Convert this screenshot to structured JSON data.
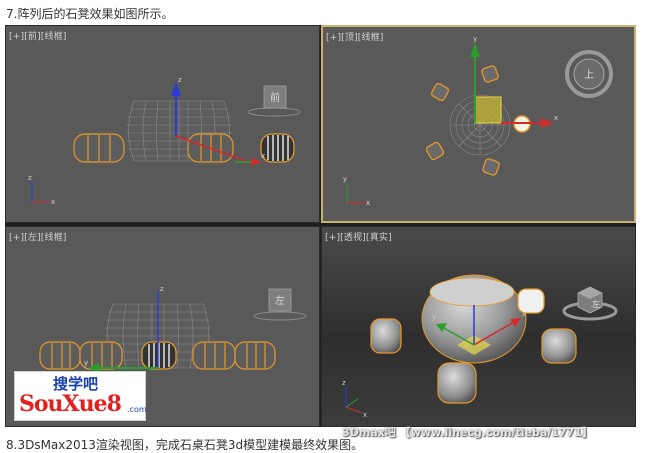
{
  "captions": {
    "top": "7.阵列后的石凳效果如图所示。",
    "bottom": "8.3DsMax2013渲染视图，完成石桌石凳3d模型建模最终效果图。"
  },
  "viewports": [
    {
      "id": "front",
      "label": "[+][前][线框]",
      "viewcube_label": "前",
      "active": false,
      "axis_labels": {
        "horizontal": "x",
        "vertical": "z"
      }
    },
    {
      "id": "top",
      "label": "[+][顶][线框]",
      "viewcube_label": "上",
      "active": true,
      "axis_labels": {
        "horizontal": "x",
        "vertical": "y"
      }
    },
    {
      "id": "left",
      "label": "[+][左][线框]",
      "viewcube_label": "左",
      "active": false,
      "axis_labels": {
        "horizontal": "y",
        "vertical": "z"
      }
    },
    {
      "id": "perspective",
      "label": "[+][透视][真实]",
      "viewcube_label": "左",
      "active": false,
      "axis_labels": {
        "horizontal": "x",
        "vertical": "z"
      }
    }
  ],
  "logo": {
    "top_text": "搜学吧",
    "main_text": "SouXue8",
    "suffix": ".com"
  },
  "watermark": "3Dmax吧 【www.linecg.com/tieba/1771】",
  "colors": {
    "selection": "#e59a2a",
    "axis_x": "#d42a2a",
    "axis_y": "#2aa02a",
    "axis_z": "#2a3ad4",
    "gizmo_plane": "#e7d84a",
    "active_border": "#c8b26c"
  }
}
